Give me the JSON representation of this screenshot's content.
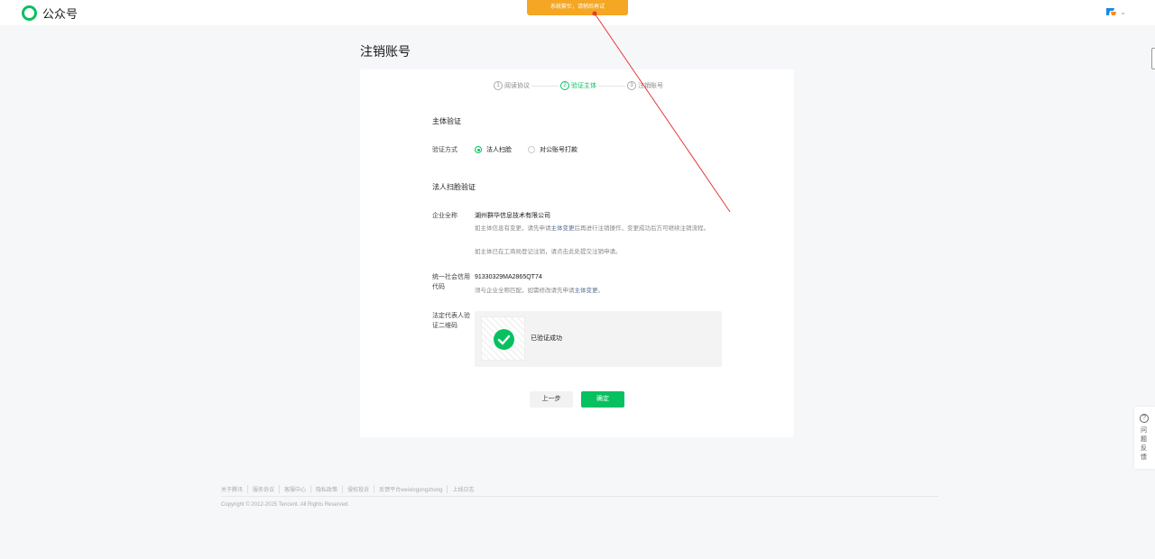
{
  "header": {
    "logo_text": "公众号",
    "account_icon": "account-logo-icon",
    "account_chevron": "chevron-down-icon"
  },
  "notice": {
    "text": "系统繁忙，请稍后再试"
  },
  "page": {
    "title": "注销账号"
  },
  "steps": [
    {
      "number": "1",
      "label": "阅读协议",
      "active": false
    },
    {
      "number": "2",
      "label": "验证主体",
      "active": true
    },
    {
      "number": "3",
      "label": "注销账号",
      "active": false
    }
  ],
  "form": {
    "section_subject": "主体验证",
    "method_label": "验证方式",
    "method_options": [
      {
        "label": "法人扫脸",
        "checked": true
      },
      {
        "label": "对公账号打款",
        "checked": false
      }
    ],
    "section_face": "法人扫脸验证",
    "company_label": "企业全称",
    "company_value": "湖州群华信息技术有限公司",
    "company_hint_1_pre": "如主体信息有变更，请先申请",
    "company_hint_1_link": "主体变更",
    "company_hint_1_post": "后再进行注销操作，变更成功后方可继续注销流程。",
    "company_hint_2": "如主体已在工商局登记注销，请点击此处提交注销申请。",
    "credit_label": "统一社会信用代码",
    "credit_value": "91330329MA2865QT74",
    "credit_hint_pre": "须与企业全称匹配，如需修改请先申请",
    "credit_hint_link": "主体变更",
    "credit_hint_post": "。",
    "legal_label": "法定代表人验证二维码",
    "verify_status": "已验证成功"
  },
  "buttons": {
    "prev": "上一步",
    "confirm": "确定"
  },
  "side_float": {
    "icon_text": "?",
    "label": "问题反馈"
  },
  "footer": {
    "links": [
      "关于腾讯",
      "服务协议",
      "客服中心",
      "隐私政策",
      "侵权投诉",
      "反馈平台weixingongzhong",
      "上线日志"
    ],
    "copyright": "Copyright © 2012-2025 Tencent. All Rights Reserved."
  },
  "colors": {
    "brand_green": "#07c160",
    "notice_orange": "#f5a623",
    "annotation_red": "#e53935"
  }
}
